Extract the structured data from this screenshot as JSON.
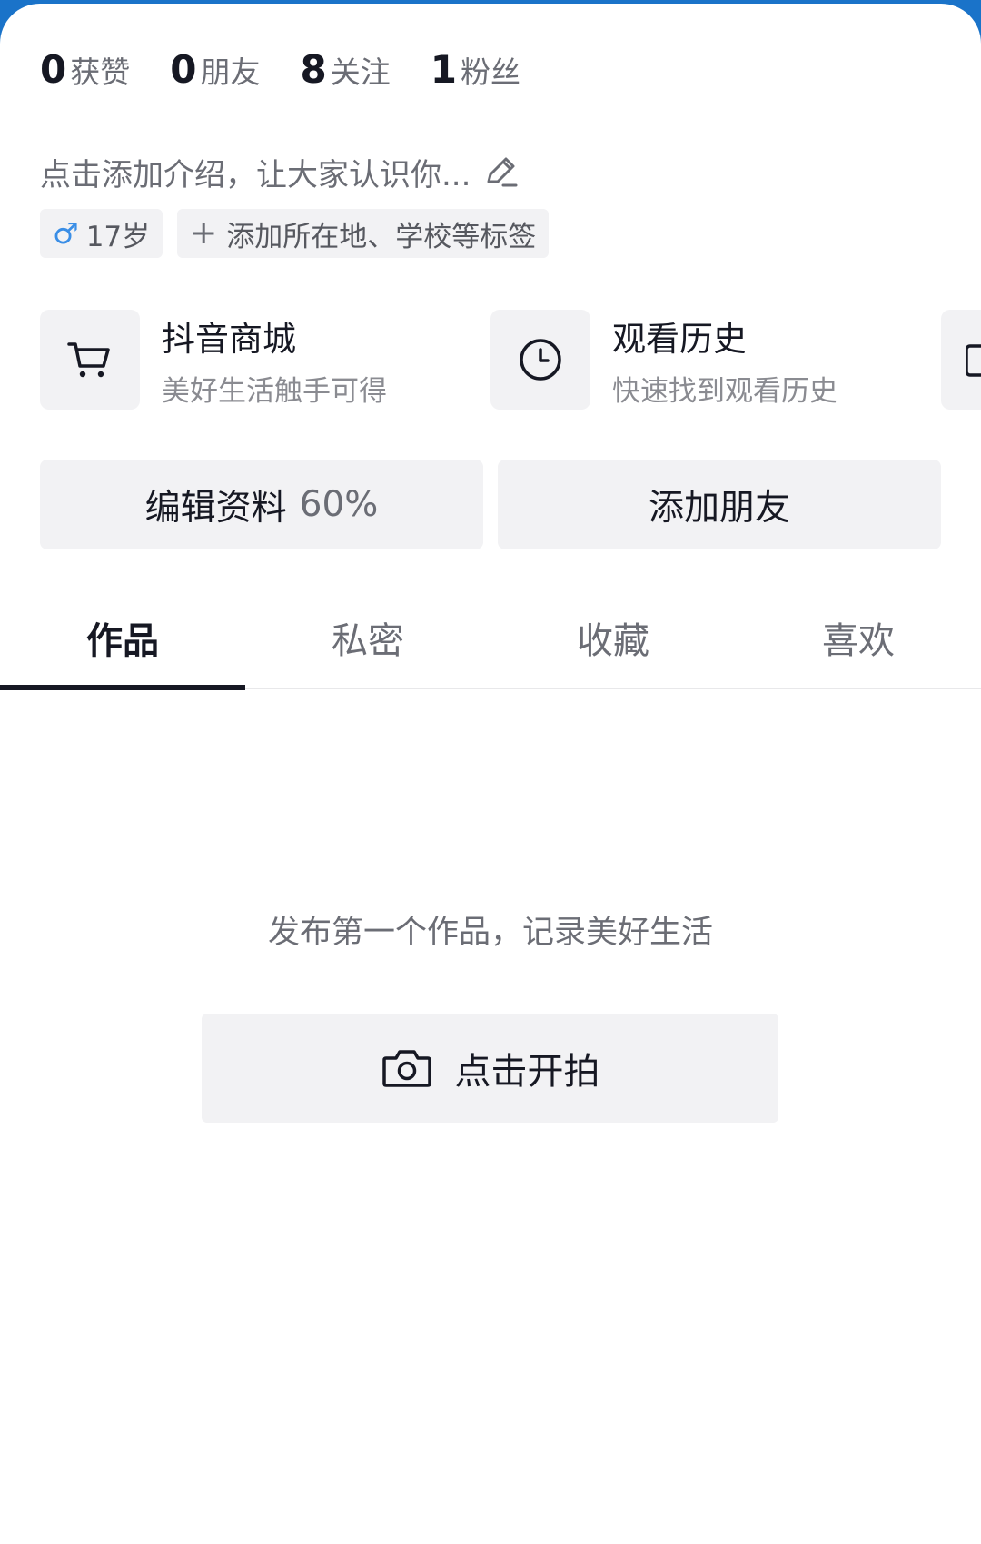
{
  "stats": [
    {
      "num": "0",
      "label": "获赞"
    },
    {
      "num": "0",
      "label": "朋友"
    },
    {
      "num": "8",
      "label": "关注"
    },
    {
      "num": "1",
      "label": "粉丝"
    }
  ],
  "bio": {
    "placeholder": "点击添加介绍，让大家认识你..."
  },
  "tags": {
    "age": {
      "gender_symbol": "♂",
      "text": "17岁"
    },
    "add": {
      "text": "添加所在地、学校等标签"
    }
  },
  "shortcuts": [
    {
      "title": "抖音商城",
      "subtitle": "美好生活触手可得",
      "icon": "cart-icon"
    },
    {
      "title": "观看历史",
      "subtitle": "快速找到观看历史",
      "icon": "clock-icon"
    }
  ],
  "actions": {
    "edit_label": "编辑资料",
    "edit_progress": "60%",
    "add_friend_label": "添加朋友"
  },
  "tabs": [
    {
      "label": "作品",
      "active": true
    },
    {
      "label": "私密",
      "active": false
    },
    {
      "label": "收藏",
      "active": false
    },
    {
      "label": "喜欢",
      "active": false
    }
  ],
  "empty": {
    "message": "发布第一个作品，记录美好生活",
    "button_label": "点击开拍"
  },
  "colors": {
    "top_bar": "#1a73c9",
    "chip_bg": "#f2f2f4",
    "gender": "#3a8ee6",
    "text_primary": "#161823",
    "text_secondary": "#6b6d75"
  }
}
